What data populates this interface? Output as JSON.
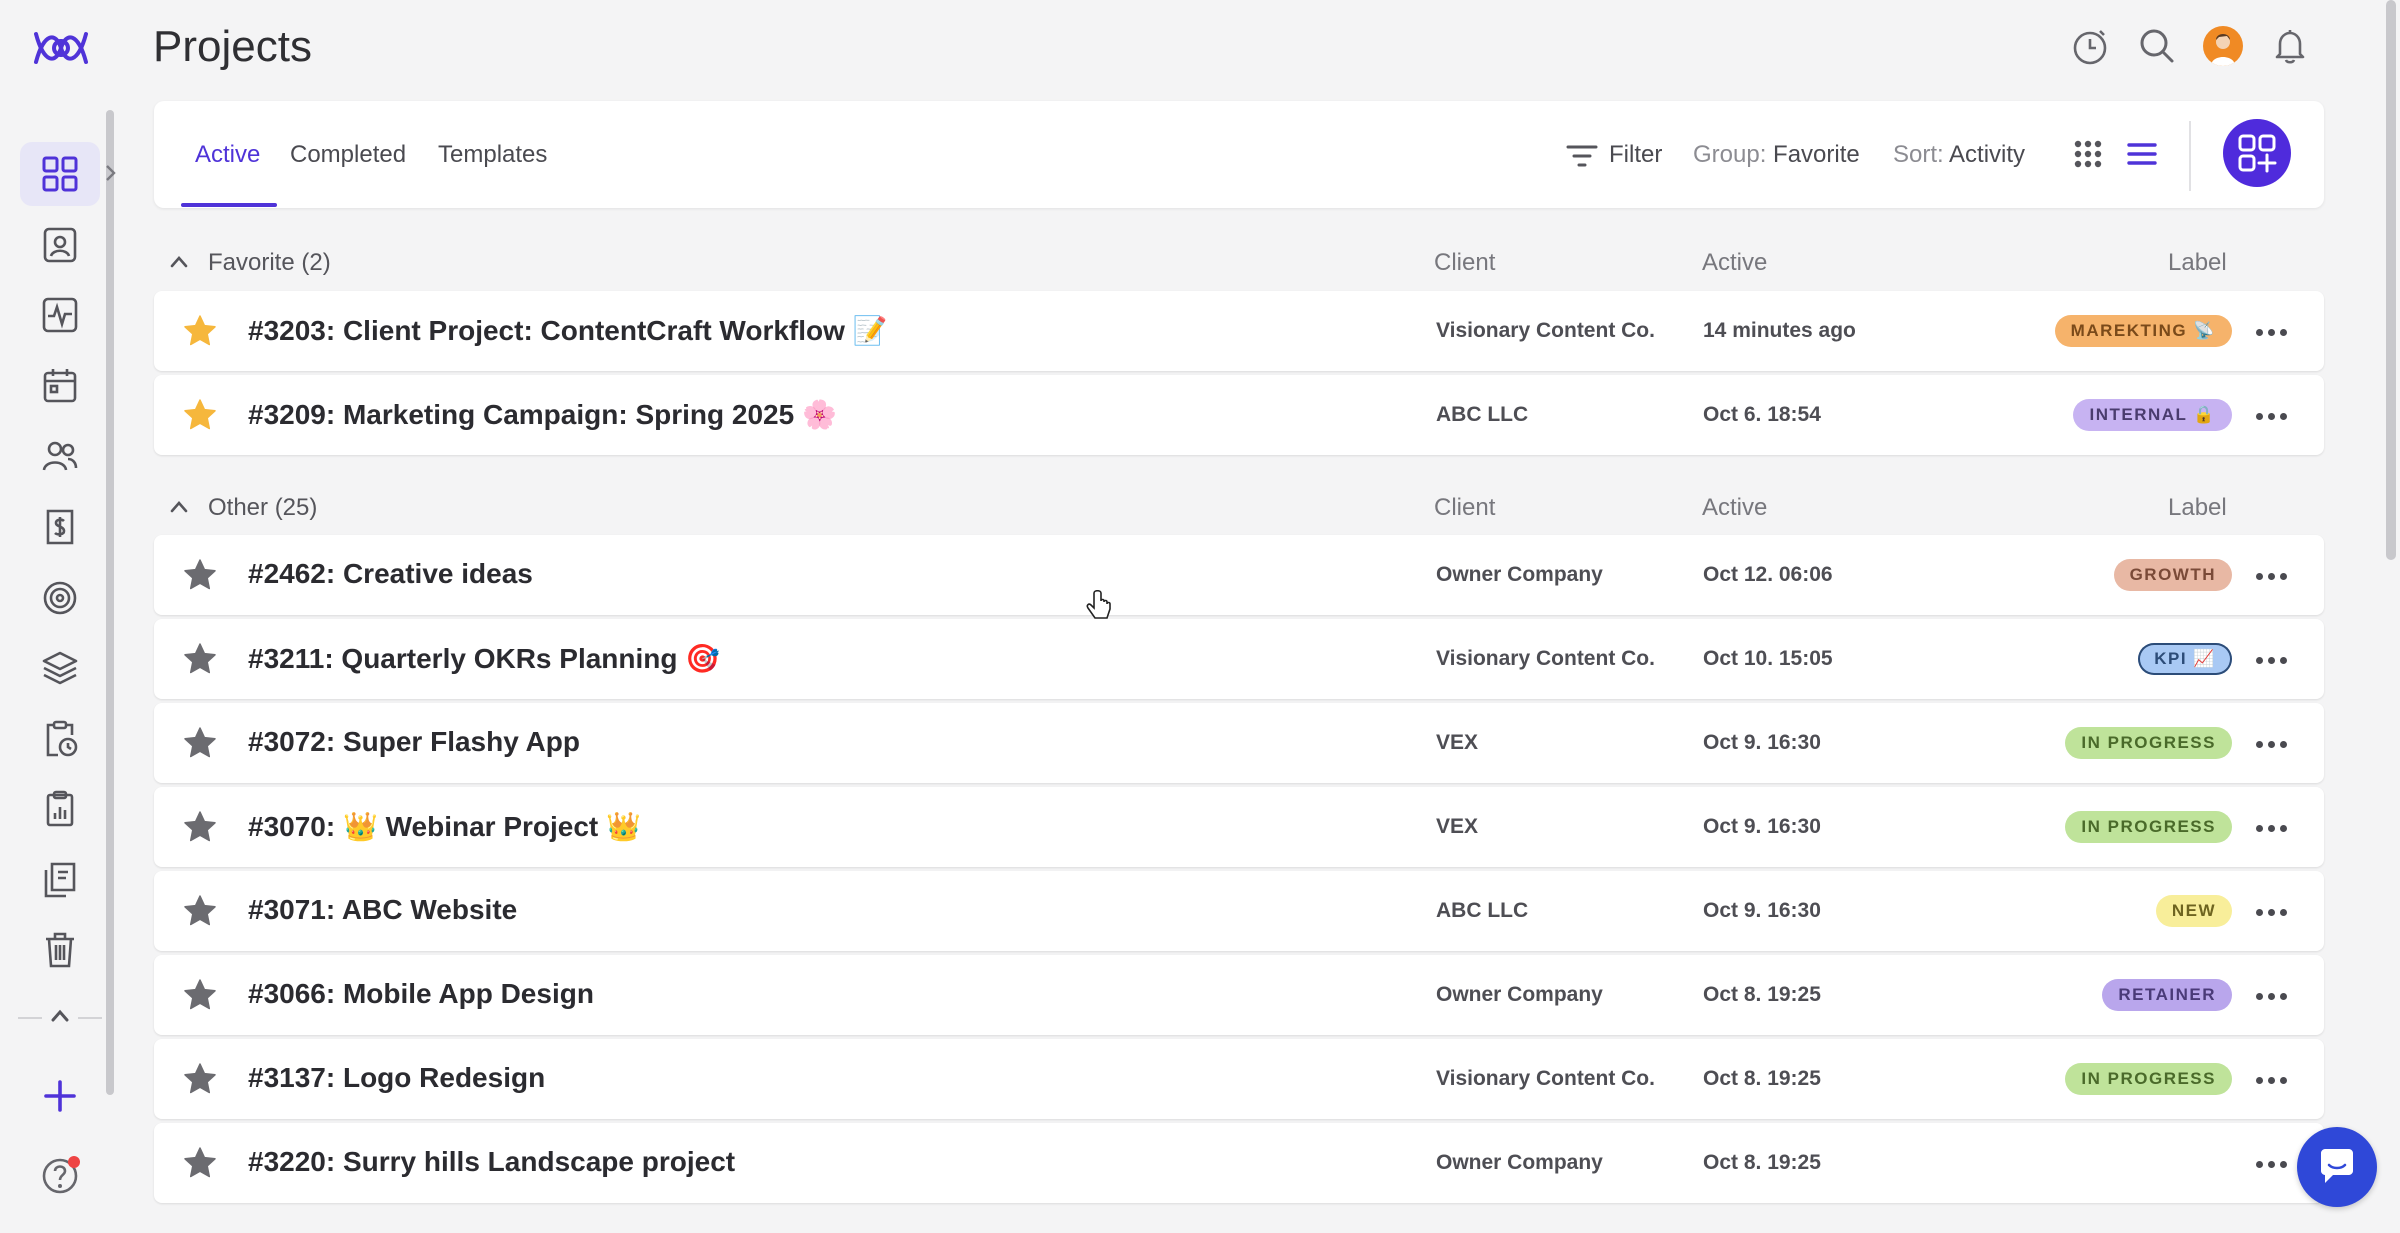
{
  "app": {
    "title": "Projects"
  },
  "tabs": [
    {
      "label": "Active",
      "selected": true
    },
    {
      "label": "Completed",
      "selected": false
    },
    {
      "label": "Templates",
      "selected": false
    }
  ],
  "toolbar": {
    "filter_label": "Filter",
    "group_prefix": "Group:",
    "group_value": "Favorite",
    "sort_prefix": "Sort:",
    "sort_value": "Activity",
    "view_mode": "list"
  },
  "columns": {
    "client": "Client",
    "active": "Active",
    "label": "Label"
  },
  "groups": [
    {
      "title": "Favorite (2)",
      "rows": [
        {
          "title": "#3203: Client Project: ContentCraft Workflow 📝",
          "client": "Visionary Content Co.",
          "active": "14 minutes ago",
          "label": "MAREKTING 📡",
          "label_bg": "#f6b36b",
          "label_fg": "#7a4a1a",
          "favorite": true
        },
        {
          "title": "#3209: Marketing Campaign: Spring 2025 🌸",
          "client": "ABC LLC",
          "active": "Oct 6. 18:54",
          "label": "INTERNAL 🔒",
          "label_bg": "#c7b3f2",
          "label_fg": "#4a3c6e",
          "favorite": true
        }
      ]
    },
    {
      "title": "Other (25)",
      "rows": [
        {
          "title": "#2462: Creative ideas",
          "client": "Owner Company",
          "active": "Oct 12. 06:06",
          "label": "GROWTH",
          "label_bg": "#e8b8a4",
          "label_fg": "#7a4a38",
          "favorite": false
        },
        {
          "title": "#3211: Quarterly OKRs Planning 🎯",
          "client": "Visionary Content Co.",
          "active": "Oct 10. 15:05",
          "label": "KPI 📈",
          "label_bg": "#a9c9f4",
          "label_fg": "#2c4c78",
          "favorite": false
        },
        {
          "title": "#3072: Super Flashy App",
          "client": "VEX",
          "active": "Oct 9. 16:30",
          "label": "IN PROGRESS",
          "label_bg": "#bfe39a",
          "label_fg": "#4a6a2a",
          "favorite": false
        },
        {
          "title": "#3070: 👑 Webinar Project 👑",
          "client": "VEX",
          "active": "Oct 9. 16:30",
          "label": "IN PROGRESS",
          "label_bg": "#bfe39a",
          "label_fg": "#4a6a2a",
          "favorite": false
        },
        {
          "title": "#3071: ABC Website",
          "client": "ABC LLC",
          "active": "Oct 9. 16:30",
          "label": "NEW",
          "label_bg": "#f8ee9a",
          "label_fg": "#6e6420",
          "favorite": false
        },
        {
          "title": "#3066: Mobile App Design",
          "client": "Owner Company",
          "active": "Oct 8. 19:25",
          "label": "RETAINER",
          "label_bg": "#b9a6ec",
          "label_fg": "#4a3a78",
          "favorite": false
        },
        {
          "title": "#3137: Logo Redesign",
          "client": "Visionary Content Co.",
          "active": "Oct 8. 19:25",
          "label": "IN PROGRESS",
          "label_bg": "#bfe39a",
          "label_fg": "#4a6a2a",
          "favorite": false
        },
        {
          "title": "#3220: Surry hills Landscape project",
          "client": "Owner Company",
          "active": "Oct 8. 19:25",
          "label": "",
          "label_bg": "",
          "label_fg": "",
          "favorite": false
        }
      ]
    }
  ],
  "colors": {
    "accent": "#4f33d8",
    "star_favorite": "#f6b73c",
    "star_default": "#6b6b70",
    "chat": "#2f48d8"
  }
}
